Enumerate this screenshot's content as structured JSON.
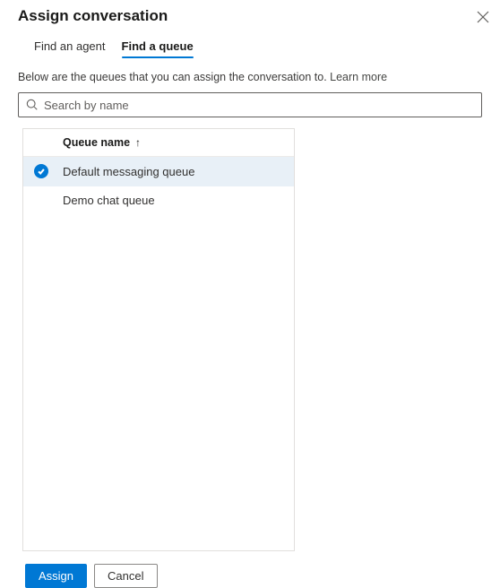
{
  "dialog": {
    "title": "Assign conversation"
  },
  "tabs": {
    "find_agent": "Find an agent",
    "find_queue": "Find a queue"
  },
  "description": {
    "text": "Below are the queues that you can assign the conversation to. ",
    "learn_more": "Learn more"
  },
  "search": {
    "placeholder": "Search by name"
  },
  "list": {
    "header": "Queue name",
    "sort_direction": "ascending",
    "items": [
      {
        "label": "Default messaging queue",
        "selected": true
      },
      {
        "label": "Demo chat queue",
        "selected": false
      }
    ]
  },
  "footer": {
    "assign": "Assign",
    "cancel": "Cancel"
  }
}
